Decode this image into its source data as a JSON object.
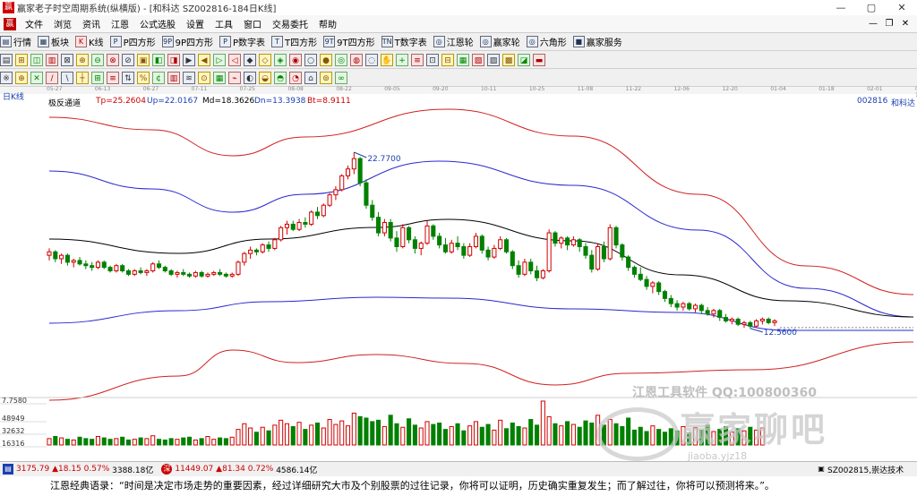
{
  "window": {
    "title": "赢家老子时空周期系统(纵横版) - [和科达  SZ002816-184日K线]",
    "controls": [
      "—",
      "▢",
      "✕"
    ]
  },
  "menu": {
    "items": [
      "文件",
      "浏览",
      "资讯",
      "江恩",
      "公式选股",
      "设置",
      "工具",
      "窗口",
      "交易委托",
      "帮助"
    ],
    "right_controls": [
      "—",
      "❐",
      "✕"
    ]
  },
  "toolbar1": [
    {
      "icon": "list-icon",
      "glyph": "▤",
      "label": "行情"
    },
    {
      "icon": "grid-icon",
      "glyph": "▦",
      "label": "板块"
    },
    {
      "icon": "kline-icon",
      "glyph": "K",
      "label": "K线"
    },
    {
      "icon": "p-square-icon",
      "glyph": "P",
      "label": "P四方形"
    },
    {
      "icon": "9p-square-icon",
      "glyph": "9P",
      "label": "9P四方形"
    },
    {
      "icon": "p-number-table-icon",
      "glyph": "P",
      "label": "P数字表"
    },
    {
      "icon": "t-square-icon",
      "glyph": "T",
      "label": "T四方形"
    },
    {
      "icon": "9t-square-icon",
      "glyph": "9T",
      "label": "9T四方形"
    },
    {
      "icon": "t-number-table-icon",
      "glyph": "TN",
      "label": "T数字表"
    },
    {
      "icon": "gann-wheel-icon",
      "glyph": "◎",
      "label": "江恩轮"
    },
    {
      "icon": "winner-wheel-icon",
      "glyph": "◎",
      "label": "赢家轮"
    },
    {
      "icon": "hexagon-icon",
      "glyph": "◎",
      "label": "六角形"
    },
    {
      "icon": "service-icon",
      "glyph": "■",
      "label": "赢家服务"
    }
  ],
  "toolbar2": [
    "▤",
    "⊞",
    "◫",
    "▥",
    "⊠",
    "⊕",
    "⊖",
    "⊗",
    "⊘",
    "▣",
    "◧",
    "◨",
    "▶",
    "◀",
    "▷",
    "◁",
    "◆",
    "◇",
    "◈",
    "◉",
    "○",
    "●",
    "◎",
    "◍",
    "◌",
    "✋",
    "+",
    "≡",
    "⊡",
    "⊟",
    "▦",
    "▧",
    "▨",
    "▩",
    "◪",
    "▬"
  ],
  "toolbar3": [
    "※",
    "⊕",
    "✕",
    "/",
    "\\",
    "┼",
    "⊞",
    "≡",
    "⇅",
    "%",
    "¢",
    "▥",
    "≋",
    "⊙",
    "▦",
    "⌁",
    "◐",
    "◒",
    "◓",
    "◔",
    "⌂",
    "⊚",
    "∞"
  ],
  "date_axis": [
    "05-27",
    "06-13",
    "06-27",
    "07-11",
    "07-25",
    "08-08",
    "08-22",
    "09-05",
    "09-20",
    "10-11",
    "10-25",
    "11-08",
    "11-22",
    "12-06",
    "12-20",
    "01-04",
    "01-18",
    "02-01",
    "02-15"
  ],
  "row_label": "日K线",
  "indicator": {
    "name": "极反通道",
    "tp": "Tp=25.2604",
    "up": "Up=22.0167",
    "md": "Md=18.3626",
    "dn": "Dn=13.3938",
    "bt": "Bt=8.9111",
    "code": "002816",
    "stock_name": "和科达"
  },
  "volume_labels": [
    "7.7580",
    "48949",
    "32632",
    "16316"
  ],
  "status": {
    "sh_index": "3175.79",
    "sh_change": "▲18.15",
    "sh_pct": "0.57%",
    "sh_amount": "3388.18亿",
    "sz_index": "11449.07",
    "sz_change": "▲81.34",
    "sz_pct": "0.72%",
    "sz_amount": "4586.14亿",
    "right_text": "SZ002815,崇达技术"
  },
  "quote": "江恩经典语录：“时间是决定市场走势的重要因素，经过详细研究大市及个别股票的过往记录，你将可以证明，历史确实重复发生；而了解过往，你将可以预测将来。”。",
  "watermark": {
    "line1": "江恩工具软件  QQ:100800360",
    "line2": "赢家聊吧",
    "line3": "jiaoba.yjz18"
  },
  "colors": {
    "up_candle": "#d00000",
    "down_candle": "#008000",
    "channel_outer": "#d02020",
    "channel_inner": "#2828d0",
    "mid_line": "#000000",
    "volume": "#008000",
    "accent": "#1a3fb0"
  },
  "chart_data": {
    "type": "candlestick",
    "price_axis_labels_shown": false,
    "annotations": [
      {
        "text": "22.7700",
        "kind": "high"
      },
      {
        "text": "12.5600",
        "kind": "low"
      }
    ],
    "series": [
      {
        "name": "Tp",
        "last": 25.2604
      },
      {
        "name": "Up",
        "last": 22.0167
      },
      {
        "name": "Md",
        "last": 18.3626
      },
      {
        "name": "Dn",
        "last": 13.3938
      },
      {
        "name": "Bt",
        "last": 8.9111
      }
    ],
    "ohlc": [
      [
        16.8,
        17.2,
        16.5,
        17.0
      ],
      [
        17.0,
        17.1,
        16.4,
        16.6
      ],
      [
        16.6,
        16.9,
        16.3,
        16.8
      ],
      [
        16.8,
        16.9,
        16.2,
        16.4
      ],
      [
        16.4,
        16.6,
        16.1,
        16.5
      ],
      [
        16.5,
        16.7,
        16.2,
        16.3
      ],
      [
        16.3,
        16.5,
        16.0,
        16.2
      ],
      [
        16.2,
        16.4,
        15.9,
        16.1
      ],
      [
        16.1,
        16.5,
        16.0,
        16.4
      ],
      [
        16.4,
        16.5,
        16.0,
        16.1
      ],
      [
        16.1,
        16.2,
        15.8,
        15.9
      ],
      [
        15.9,
        16.3,
        15.8,
        16.2
      ],
      [
        16.2,
        16.3,
        15.8,
        15.9
      ],
      [
        15.9,
        16.0,
        15.6,
        15.7
      ],
      [
        15.7,
        16.0,
        15.6,
        15.9
      ],
      [
        15.9,
        16.1,
        15.7,
        15.8
      ],
      [
        15.8,
        16.0,
        15.6,
        15.9
      ],
      [
        15.9,
        16.4,
        15.8,
        16.3
      ],
      [
        16.3,
        16.5,
        16.0,
        16.1
      ],
      [
        16.1,
        16.2,
        15.8,
        15.9
      ],
      [
        15.9,
        16.0,
        15.6,
        15.7
      ],
      [
        15.7,
        15.9,
        15.5,
        15.8
      ],
      [
        15.8,
        16.0,
        15.6,
        15.7
      ],
      [
        15.7,
        15.8,
        15.5,
        15.6
      ],
      [
        15.6,
        15.9,
        15.5,
        15.8
      ],
      [
        15.8,
        15.9,
        15.5,
        15.6
      ],
      [
        15.6,
        15.8,
        15.5,
        15.7
      ],
      [
        15.7,
        15.9,
        15.6,
        15.8
      ],
      [
        15.8,
        16.0,
        15.6,
        15.7
      ],
      [
        15.7,
        15.8,
        15.5,
        15.6
      ],
      [
        15.6,
        15.8,
        15.5,
        15.7
      ],
      [
        15.7,
        16.5,
        15.6,
        16.4
      ],
      [
        16.4,
        17.0,
        16.2,
        16.9
      ],
      [
        16.9,
        17.3,
        16.6,
        17.1
      ],
      [
        17.1,
        17.2,
        16.8,
        17.0
      ],
      [
        17.0,
        17.5,
        16.9,
        17.4
      ],
      [
        17.4,
        17.6,
        17.0,
        17.2
      ],
      [
        17.2,
        17.8,
        17.1,
        17.7
      ],
      [
        17.7,
        18.5,
        17.6,
        18.4
      ],
      [
        18.4,
        18.8,
        18.0,
        18.6
      ],
      [
        18.6,
        18.8,
        18.2,
        18.3
      ],
      [
        18.3,
        18.9,
        18.2,
        18.7
      ],
      [
        18.7,
        19.0,
        18.4,
        18.6
      ],
      [
        18.6,
        19.4,
        18.5,
        19.3
      ],
      [
        19.3,
        19.6,
        18.9,
        19.1
      ],
      [
        19.1,
        19.8,
        19.0,
        19.7
      ],
      [
        19.7,
        20.4,
        19.6,
        20.3
      ],
      [
        20.3,
        20.8,
        20.0,
        20.6
      ],
      [
        20.6,
        21.5,
        20.5,
        21.4
      ],
      [
        21.4,
        22.0,
        21.2,
        21.8
      ],
      [
        21.8,
        22.77,
        21.5,
        22.4
      ],
      [
        22.4,
        22.5,
        20.8,
        21.0
      ],
      [
        21.0,
        21.2,
        19.5,
        19.7
      ],
      [
        19.7,
        20.0,
        18.8,
        19.0
      ],
      [
        19.0,
        19.3,
        17.9,
        18.1
      ],
      [
        18.1,
        18.9,
        17.9,
        18.7
      ],
      [
        18.7,
        18.9,
        17.6,
        17.8
      ],
      [
        17.8,
        18.2,
        17.0,
        17.3
      ],
      [
        17.3,
        18.6,
        17.2,
        18.4
      ],
      [
        18.4,
        18.5,
        17.5,
        17.7
      ],
      [
        17.7,
        17.9,
        16.9,
        17.2
      ],
      [
        17.2,
        17.6,
        16.8,
        17.5
      ],
      [
        17.5,
        18.8,
        17.4,
        18.5
      ],
      [
        18.5,
        18.6,
        17.7,
        17.9
      ],
      [
        17.9,
        18.1,
        17.2,
        17.4
      ],
      [
        17.4,
        17.8,
        16.9,
        17.0
      ],
      [
        17.0,
        17.7,
        16.9,
        17.5
      ],
      [
        17.5,
        17.9,
        17.1,
        17.3
      ],
      [
        17.3,
        17.5,
        16.6,
        16.8
      ],
      [
        16.8,
        17.5,
        16.7,
        17.3
      ],
      [
        17.3,
        18.1,
        17.2,
        17.9
      ],
      [
        17.9,
        18.0,
        16.9,
        17.1
      ],
      [
        17.1,
        17.3,
        16.5,
        16.7
      ],
      [
        16.7,
        17.4,
        16.6,
        17.2
      ],
      [
        17.2,
        17.9,
        17.1,
        17.7
      ],
      [
        17.7,
        17.8,
        16.9,
        17.0
      ],
      [
        17.0,
        17.1,
        16.0,
        16.2
      ],
      [
        16.2,
        16.5,
        15.5,
        15.7
      ],
      [
        15.7,
        16.6,
        15.6,
        16.4
      ],
      [
        16.4,
        16.6,
        15.7,
        15.9
      ],
      [
        15.9,
        16.2,
        15.3,
        15.5
      ],
      [
        15.5,
        16.0,
        15.4,
        15.9
      ],
      [
        15.9,
        18.3,
        15.8,
        18.1
      ],
      [
        18.1,
        18.2,
        17.3,
        17.5
      ],
      [
        17.5,
        17.9,
        17.2,
        17.8
      ],
      [
        17.8,
        17.9,
        17.1,
        17.4
      ],
      [
        17.4,
        17.9,
        17.3,
        17.7
      ],
      [
        17.7,
        17.8,
        17.0,
        17.3
      ],
      [
        17.3,
        17.5,
        16.6,
        16.8
      ],
      [
        16.8,
        17.1,
        15.8,
        16.0
      ],
      [
        16.0,
        17.5,
        15.9,
        17.3
      ],
      [
        17.3,
        17.6,
        16.4,
        16.6
      ],
      [
        16.6,
        18.6,
        16.5,
        18.4
      ],
      [
        18.4,
        18.5,
        17.2,
        17.4
      ],
      [
        17.4,
        17.5,
        16.5,
        16.7
      ],
      [
        16.7,
        16.8,
        15.9,
        16.1
      ],
      [
        16.1,
        16.2,
        15.5,
        15.7
      ],
      [
        15.7,
        16.1,
        15.3,
        15.4
      ],
      [
        15.4,
        15.6,
        14.8,
        15.0
      ],
      [
        15.0,
        15.3,
        14.6,
        15.2
      ],
      [
        15.2,
        15.3,
        14.5,
        14.7
      ],
      [
        14.7,
        14.8,
        14.1,
        14.3
      ],
      [
        14.3,
        14.5,
        13.8,
        14.0
      ],
      [
        14.0,
        14.2,
        13.6,
        13.8
      ],
      [
        13.8,
        14.1,
        13.6,
        14.0
      ],
      [
        14.0,
        14.1,
        13.6,
        13.7
      ],
      [
        13.7,
        14.0,
        13.5,
        13.9
      ],
      [
        13.9,
        14.0,
        13.4,
        13.6
      ],
      [
        13.6,
        13.8,
        13.3,
        13.4
      ],
      [
        13.4,
        13.7,
        13.2,
        13.6
      ],
      [
        13.6,
        13.7,
        13.0,
        13.2
      ],
      [
        13.2,
        13.4,
        12.9,
        13.0
      ],
      [
        13.0,
        13.2,
        12.8,
        13.1
      ],
      [
        13.1,
        13.2,
        12.7,
        12.8
      ],
      [
        12.8,
        13.0,
        12.6,
        12.9
      ],
      [
        12.9,
        13.0,
        12.56,
        12.7
      ],
      [
        12.7,
        13.1,
        12.6,
        13.0
      ],
      [
        13.0,
        13.2,
        12.8,
        13.1
      ],
      [
        13.1,
        13.2,
        12.8,
        12.9
      ],
      [
        12.9,
        13.1,
        12.7,
        13.0
      ]
    ],
    "volume": [
      9,
      12,
      10,
      8,
      7,
      11,
      9,
      8,
      12,
      10,
      8,
      9,
      11,
      7,
      8,
      10,
      9,
      13,
      8,
      7,
      9,
      8,
      10,
      11,
      7,
      9,
      12,
      8,
      10,
      9,
      11,
      22,
      30,
      24,
      18,
      25,
      20,
      28,
      35,
      30,
      26,
      32,
      22,
      28,
      31,
      24,
      36,
      29,
      34,
      27,
      45,
      40,
      38,
      33,
      35,
      26,
      42,
      30,
      25,
      37,
      28,
      24,
      33,
      29,
      31,
      22,
      26,
      30,
      20,
      27,
      33,
      25,
      29,
      21,
      35,
      23,
      31,
      26,
      24,
      36,
      28,
      62,
      40,
      30,
      27,
      33,
      29,
      25,
      34,
      31,
      42,
      28,
      36,
      30,
      26,
      38,
      21,
      25,
      19,
      27,
      22,
      18,
      23,
      20,
      26,
      17,
      24,
      21,
      28,
      19,
      22,
      26,
      18,
      23,
      20,
      25,
      21,
      24
    ]
  }
}
